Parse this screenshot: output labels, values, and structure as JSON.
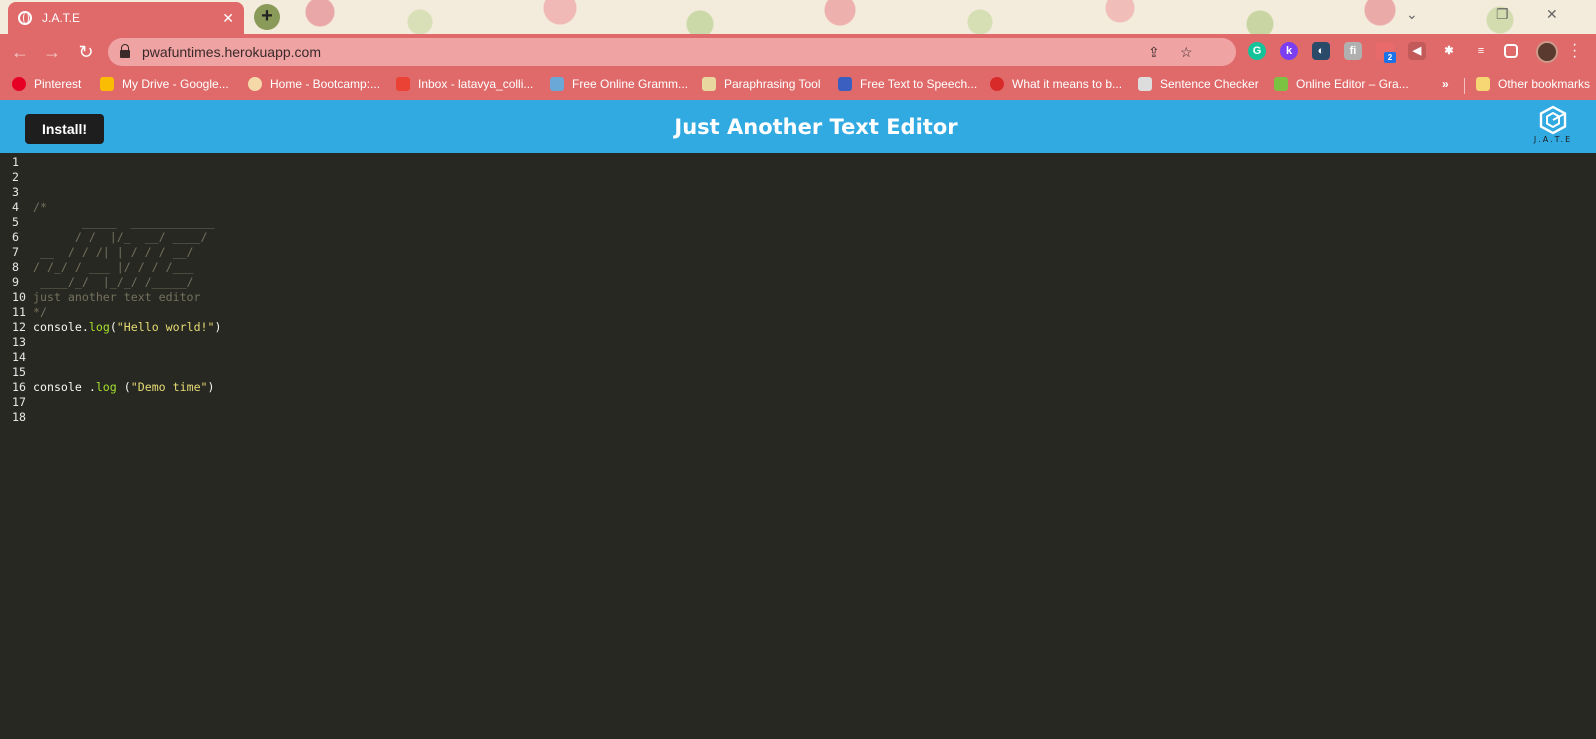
{
  "browser": {
    "tab_title": "J.A.T.E",
    "tab_close": "✕",
    "new_tab": "+",
    "url": "pwafuntimes.herokuapp.com",
    "extension_badge": "2",
    "bookmarks": [
      {
        "label": "Pinterest",
        "color": "#e60023"
      },
      {
        "label": "My Drive - Google...",
        "color": "#fbbc04"
      },
      {
        "label": "Home - Bootcamp:...",
        "color": "#f5d9a8"
      },
      {
        "label": "Inbox - latavya_colli...",
        "color": "#ea4335"
      },
      {
        "label": "Free Online Gramm...",
        "color": "#6aa8d8"
      },
      {
        "label": "Paraphrasing Tool",
        "color": "#e8d8a0"
      },
      {
        "label": "Free Text to Speech...",
        "color": "#3b5fc0"
      },
      {
        "label": "What it means to b...",
        "color": "#d92a2a"
      },
      {
        "label": "Sentence Checker",
        "color": "#dddddd"
      },
      {
        "label": "Online Editor – Gra...",
        "color": "#7cc242"
      }
    ],
    "more_bookmarks": "»",
    "other_bookmarks": "Other bookmarks"
  },
  "app": {
    "install_label": "Install!",
    "title": "Just Another Text Editor",
    "logo_text": "J.A.T.E"
  },
  "editor": {
    "line_numbers": [
      "1",
      "2",
      "3",
      "4",
      "5",
      "6",
      "7",
      "8",
      "9",
      "10",
      "11",
      "12",
      "13",
      "14",
      "15",
      "16",
      "17",
      "18"
    ],
    "lines": {
      "l4": "/*",
      "l5": "       _____  ____________",
      "l6": "      / /  |/_  __/ ____/",
      "l7": " __  / / /| | / / / __/",
      "l8": "/ /_/ / ___ |/ / / /___",
      "l9": " ____/_/  |_/_/ /_____/",
      "l10": "just another text editor",
      "l11": "*/",
      "l12_obj": "console",
      "l12_dot": ".",
      "l12_fn": "log",
      "l12_open": "(",
      "l12_str": "\"Hello world!\"",
      "l12_close": ")",
      "l16_obj": "console ",
      "l16_dot": ".",
      "l16_fn": "log",
      "l16_open": " (",
      "l16_str": "\"Demo time\"",
      "l16_close": ")"
    }
  }
}
